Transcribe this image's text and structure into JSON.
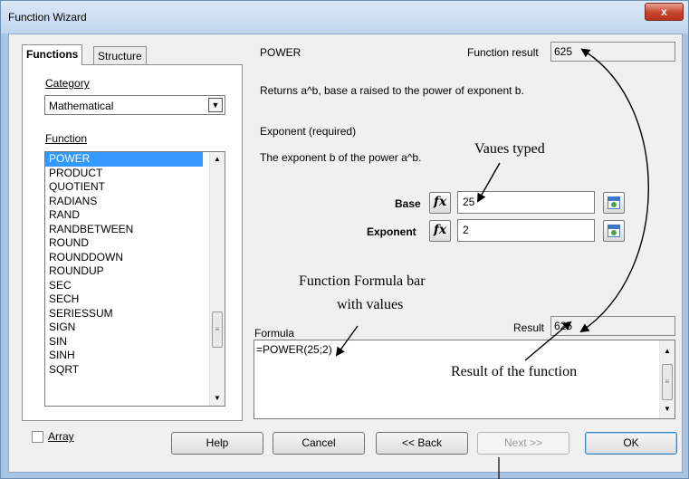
{
  "window": {
    "title": "Function Wizard",
    "close_label": "x"
  },
  "tabs": {
    "functions": "Functions",
    "structure": "Structure"
  },
  "category": {
    "label": "Category",
    "value": "Mathematical"
  },
  "function_list": {
    "label": "Function",
    "items": [
      "POWER",
      "PRODUCT",
      "QUOTIENT",
      "RADIANS",
      "RAND",
      "RANDBETWEEN",
      "ROUND",
      "ROUNDDOWN",
      "ROUNDUP",
      "SEC",
      "SECH",
      "SERIESSUM",
      "SIGN",
      "SIN",
      "SINH",
      "SQRT"
    ],
    "selected": "POWER"
  },
  "detail": {
    "function_name": "POWER",
    "function_result_label": "Function result",
    "function_result_value": "625",
    "description": "Returns a^b, base a raised to the power of exponent b.",
    "arg_title": "Exponent (required)",
    "arg_description": "The exponent b of the power a^b."
  },
  "args": {
    "base_label": "Base",
    "base_value": "25",
    "exponent_label": "Exponent",
    "exponent_value": "2",
    "fx_label": "fx"
  },
  "formula": {
    "label": "Formula",
    "value": "=POWER(25;2)",
    "result_label": "Result",
    "result_value": "625"
  },
  "array_label": "Array",
  "buttons": {
    "help": "Help",
    "cancel": "Cancel",
    "back": "<< Back",
    "next": "Next >>",
    "ok": "OK"
  },
  "annotations": {
    "values_typed": "Vaues typed",
    "formula_bar_line1": "Function Formula bar",
    "formula_bar_line2": "with values",
    "result_of_function": "Result of the function"
  },
  "colors": {
    "selection": "#3399ff",
    "window_frame": "#a9c5e4",
    "close_button": "#c7432b",
    "ok_border": "#3c7fb1"
  }
}
